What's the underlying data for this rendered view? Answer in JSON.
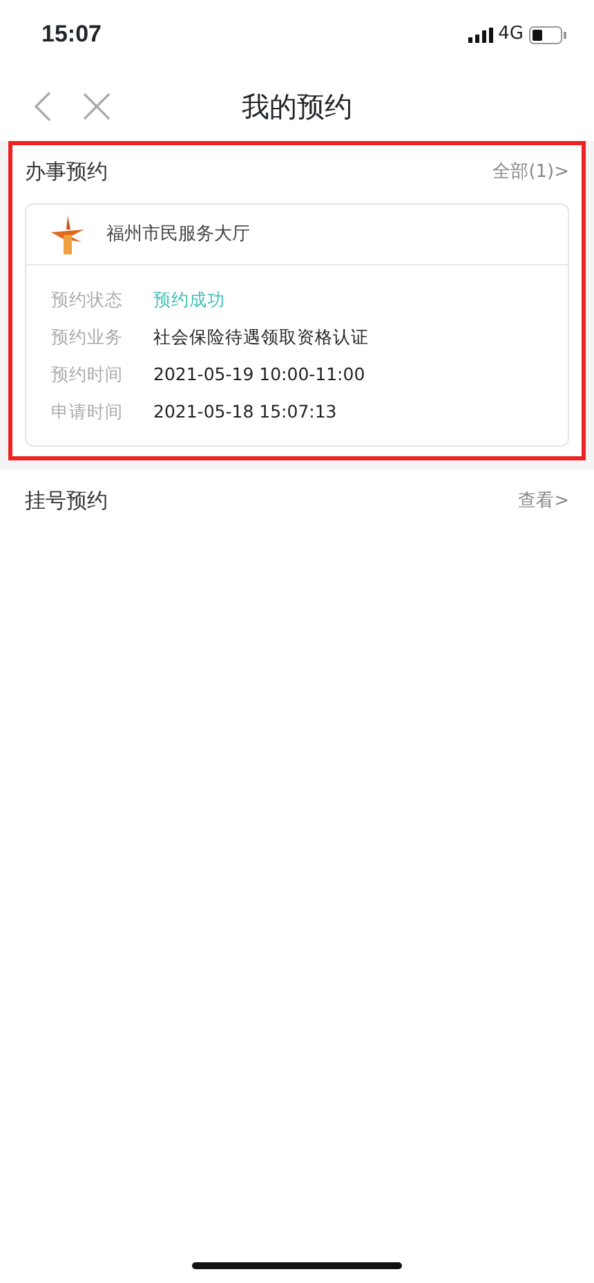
{
  "status_bar": {
    "time": "15:07",
    "network": "4G"
  },
  "nav": {
    "title": "我的预约"
  },
  "sections": [
    {
      "kind": "card",
      "title": "办事预约",
      "link": "全部(1)>",
      "highlighted": true,
      "card": {
        "org": "福州市民服务大厅",
        "fields": [
          {
            "label": "预约状态",
            "value": "预约成功",
            "kind": "status"
          },
          {
            "label": "预约业务",
            "value": "社会保险待遇领取资格认证",
            "kind": "text"
          },
          {
            "label": "预约时间",
            "value": "2021-05-19 10:00-11:00",
            "kind": "text"
          },
          {
            "label": "申请时间",
            "value": "2021-05-18 15:07:13",
            "kind": "text"
          }
        ]
      }
    },
    {
      "kind": "plain",
      "title": "挂号预约",
      "link": "查看>",
      "highlighted": false
    }
  ]
}
